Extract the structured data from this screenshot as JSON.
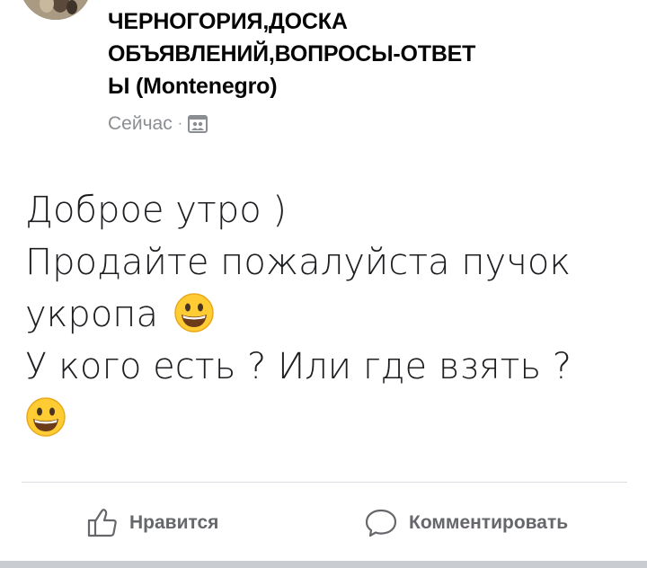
{
  "post": {
    "group_name": "ЧЕРНОГОРИЯ,ДОСКА\nОБЪЯВЛЕНИЙ,ВОПРОСЫ-ОТВЕТ\nЫ (Montenegro)",
    "timestamp": "Сейчас",
    "separator": "·",
    "audience_icon": "group-icon",
    "body_lines": [
      "Доброе утро )",
      "Продайте пожалуйста пучок",
      "укропа",
      "У кого есть ? Или где взять ?",
      ""
    ],
    "emoji_name": "grinning-face-emoji"
  },
  "actions": {
    "like_label": "Нравится",
    "comment_label": "Комментировать"
  },
  "colors": {
    "text": "#1c1e21",
    "meta": "#8a8d91",
    "action": "#65676b",
    "divider": "#dadde1",
    "emoji_face": "#ffcc33"
  }
}
